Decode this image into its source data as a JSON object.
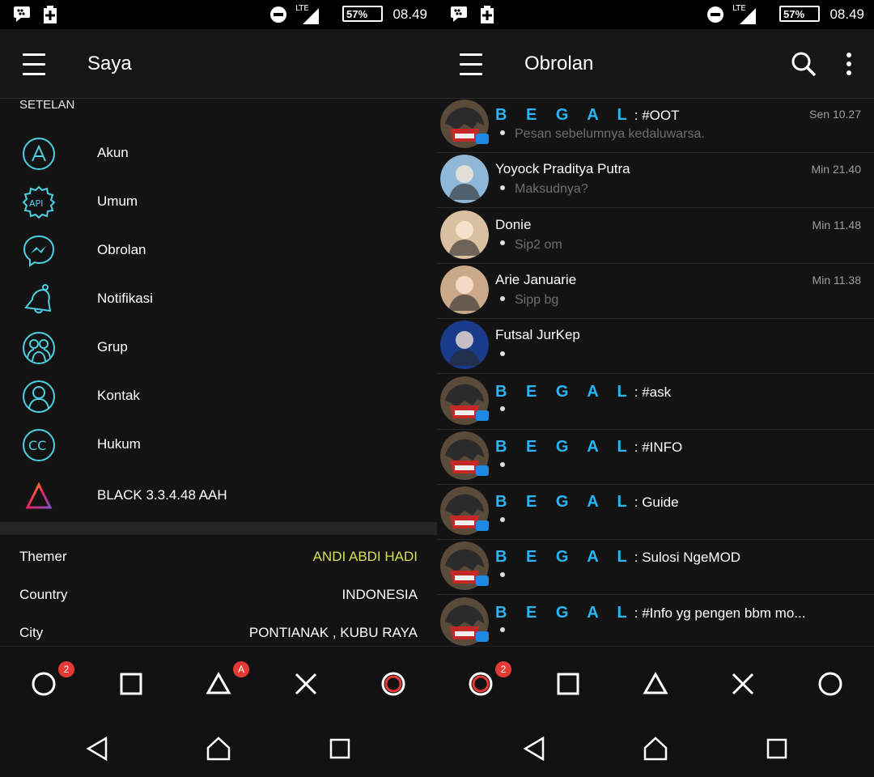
{
  "status": {
    "battery": "57%",
    "time": "08.49",
    "network": "LTE"
  },
  "colors": {
    "accent_cyan": "#4dd0e1",
    "accent_lime": "#d4e157",
    "badge_red": "#e53935",
    "bbm_blue": "#29b6f6"
  },
  "left": {
    "title": "Saya",
    "section": "SETELAN",
    "menu": [
      {
        "label": "Akun",
        "icon": "account-a-icon"
      },
      {
        "label": "Umum",
        "icon": "api-gear-icon"
      },
      {
        "label": "Obrolan",
        "icon": "messenger-icon"
      },
      {
        "label": "Notifikasi",
        "icon": "bell-icon"
      },
      {
        "label": "Grup",
        "icon": "group-icon"
      },
      {
        "label": "Kontak",
        "icon": "contact-icon"
      },
      {
        "label": "Hukum",
        "icon": "cc-icon"
      },
      {
        "label": "BLACK 3.3.4.48 AAH",
        "icon": "black-triangle-logo"
      }
    ],
    "info": [
      {
        "key": "Themer",
        "value": "ANDI ABDI HADI"
      },
      {
        "key": "Country",
        "value": "INDONESIA"
      },
      {
        "key": "City",
        "value": "PONTIANAK , KUBU RAYA"
      }
    ],
    "tabs": {
      "circle_badge": "2",
      "triangle_badge": "A"
    }
  },
  "right": {
    "title": "Obrolan",
    "group_prefix": "B E G A L",
    "chats": [
      {
        "group": true,
        "name": ": #OOT",
        "time": "Sen 10.27",
        "preview": "Pesan sebelumnya kedaluwarsa."
      },
      {
        "group": false,
        "name": "Yoyock Praditya Putra",
        "time": "Min 21.40",
        "preview": "Maksudnya?"
      },
      {
        "group": false,
        "name": "Donie",
        "time": "Min 11.48",
        "preview": "Sip2 om"
      },
      {
        "group": false,
        "name": "Arie Januarie",
        "time": "Min 11.38",
        "preview": "Sipp bg"
      },
      {
        "group": false,
        "name": "Futsal JurKep",
        "time": "",
        "preview": ""
      },
      {
        "group": true,
        "name": ": #ask",
        "time": "",
        "preview": ""
      },
      {
        "group": true,
        "name": ": #INFO",
        "time": "",
        "preview": ""
      },
      {
        "group": true,
        "name": ": Guide",
        "time": "",
        "preview": ""
      },
      {
        "group": true,
        "name": ": Sulosi NgeMOD",
        "time": "",
        "preview": ""
      },
      {
        "group": true,
        "name": ": #Info yg pengen bbm mo...",
        "time": "",
        "preview": ""
      }
    ],
    "tabs": {
      "circle_badge": "2"
    }
  }
}
